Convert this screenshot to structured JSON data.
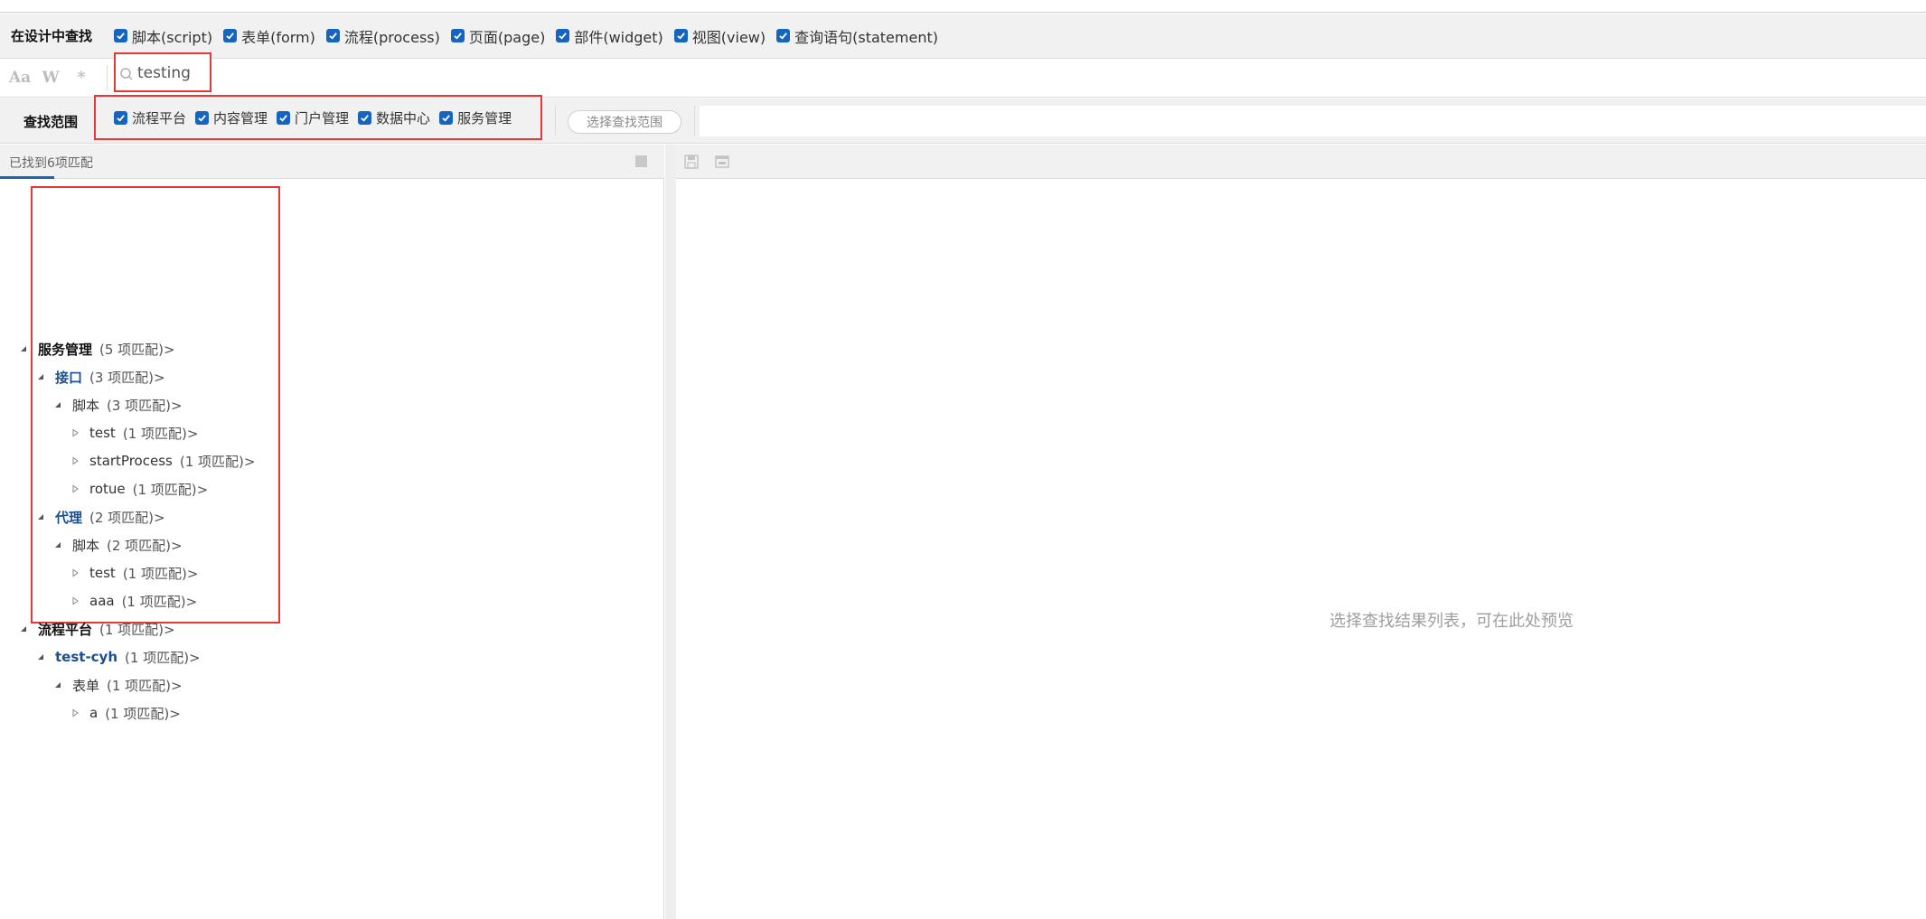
{
  "search_in_design": {
    "title": "在设计中查找",
    "types": [
      {
        "label": "脚本(script)",
        "checked": true
      },
      {
        "label": "表单(form)",
        "checked": true
      },
      {
        "label": "流程(process)",
        "checked": true
      },
      {
        "label": "页面(page)",
        "checked": true
      },
      {
        "label": "部件(widget)",
        "checked": true
      },
      {
        "label": "视图(view)",
        "checked": true
      },
      {
        "label": "查询语句(statement)",
        "checked": true
      }
    ]
  },
  "options": {
    "match_case_icon": "Aa",
    "whole_word_icon": "W",
    "regex_icon": "*"
  },
  "search": {
    "value": "testing",
    "icon": "search-icon"
  },
  "scope": {
    "title": "查找范围",
    "apps": [
      {
        "label": "流程平台",
        "checked": true
      },
      {
        "label": "内容管理",
        "checked": true
      },
      {
        "label": "门户管理",
        "checked": true
      },
      {
        "label": "数据中心",
        "checked": true
      },
      {
        "label": "服务管理",
        "checked": true
      }
    ],
    "select_button": "选择查找范围"
  },
  "results": {
    "count_text": "已找到6项匹配",
    "tree": [
      {
        "label": "服务管理",
        "count": "(5 项匹配)>"
      },
      {
        "label": "接口",
        "count": "(3 项匹配)>"
      },
      {
        "label": "脚本",
        "count": "(3 项匹配)>"
      },
      {
        "label": "test",
        "count": "(1 项匹配)>"
      },
      {
        "label": "startProcess",
        "count": "(1 项匹配)>"
      },
      {
        "label": "rotue",
        "count": "(1 项匹配)>"
      },
      {
        "label": "代理",
        "count": "(2 项匹配)>"
      },
      {
        "label": "脚本",
        "count": "(2 项匹配)>"
      },
      {
        "label": "test",
        "count": "(1 项匹配)>"
      },
      {
        "label": "aaa",
        "count": "(1 项匹配)>"
      },
      {
        "label": "流程平台",
        "count": "(1 项匹配)>"
      },
      {
        "label": "test-cyh",
        "count": "(1 项匹配)>"
      },
      {
        "label": "表单",
        "count": "(1 项匹配)>"
      },
      {
        "label": "a",
        "count": "(1 项匹配)>"
      }
    ]
  },
  "preview": {
    "hint": "选择查找结果列表，可在此处预览"
  },
  "colors": {
    "accent": "#1565c0",
    "highlight_border": "#e53935",
    "node_blue": "#1a4f8f"
  }
}
